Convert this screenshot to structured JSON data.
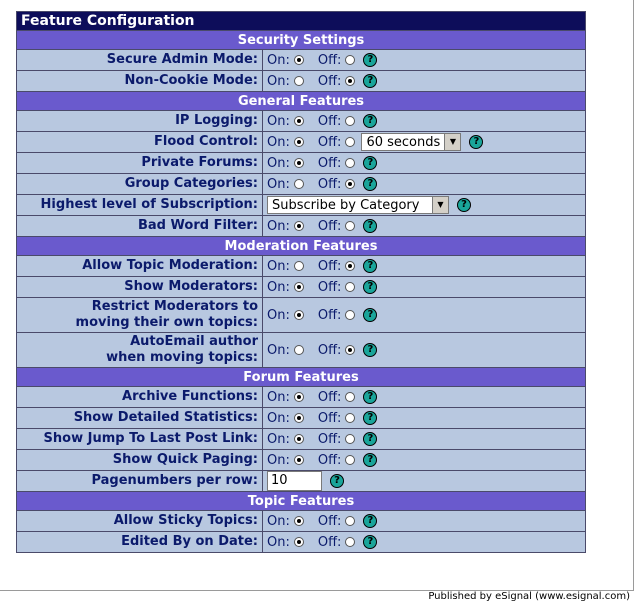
{
  "title": "Feature Configuration",
  "labels": {
    "on": "On:",
    "off": "Off:",
    "help_glyph": "?"
  },
  "sections": {
    "security": "Security Settings",
    "general": "General Features",
    "moderation": "Moderation Features",
    "forum": "Forum Features",
    "topic": "Topic Features"
  },
  "rows": {
    "secure_admin": {
      "label": "Secure Admin Mode:",
      "value": "on"
    },
    "non_cookie": {
      "label": "Non-Cookie Mode:",
      "value": "off"
    },
    "ip_logging": {
      "label": "IP Logging:",
      "value": "on"
    },
    "flood_control": {
      "label": "Flood Control:",
      "value": "on",
      "select": "60 seconds"
    },
    "private_forums": {
      "label": "Private Forums:",
      "value": "on"
    },
    "group_categories": {
      "label": "Group Categories:",
      "value": "off"
    },
    "subscription": {
      "label": "Highest level of Subscription:",
      "select": "Subscribe by Category"
    },
    "bad_word_filter": {
      "label": "Bad Word Filter:",
      "value": "on"
    },
    "allow_topic_moderation": {
      "label": "Allow Topic Moderation:",
      "value": "off"
    },
    "show_moderators": {
      "label": "Show Moderators:",
      "value": "on"
    },
    "restrict_moderators": {
      "label1": "Restrict Moderators to",
      "label2": "moving their own topics:",
      "value": "on"
    },
    "autoemail_author": {
      "label1": "AutoEmail author",
      "label2": "when moving topics:",
      "value": "off"
    },
    "archive_functions": {
      "label": "Archive Functions:",
      "value": "on"
    },
    "detailed_statistics": {
      "label": "Show Detailed Statistics:",
      "value": "on"
    },
    "jump_last_post": {
      "label": "Show Jump To Last Post Link:",
      "value": "on"
    },
    "quick_paging": {
      "label": "Show Quick Paging:",
      "value": "on"
    },
    "pagenumbers": {
      "label": "Pagenumbers per row:",
      "input_value": "10"
    },
    "sticky_topics": {
      "label": "Allow Sticky Topics:",
      "value": "on"
    },
    "edited_by": {
      "label": "Edited By on Date:",
      "value": "on"
    }
  },
  "footer": "Published by eSignal (www.esignal.com)"
}
